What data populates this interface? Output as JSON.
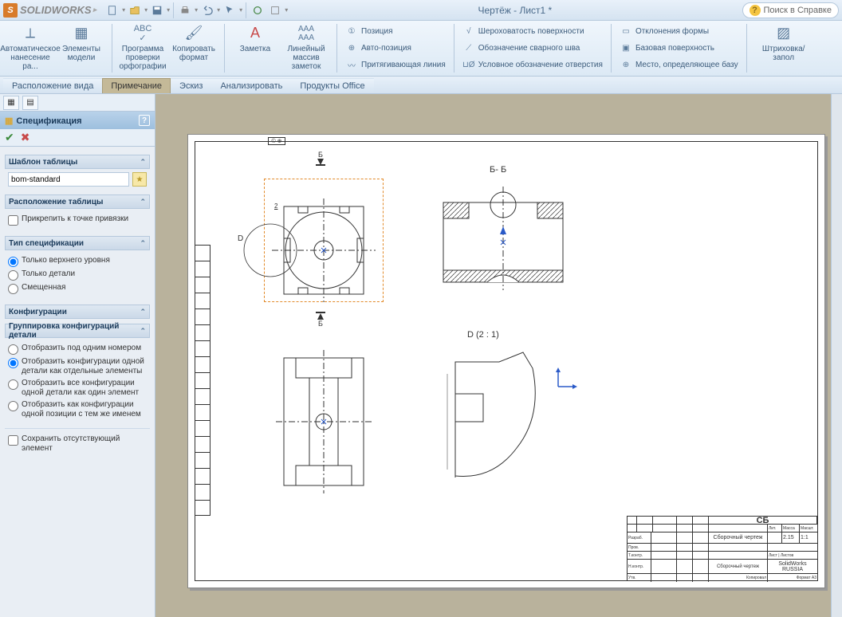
{
  "app": {
    "name": "SOLIDWORKS",
    "doc_title": "Чертёж - Лист1 *",
    "help_search": "Поиск в Справке"
  },
  "ribbon": {
    "big": [
      {
        "label1": "Автоматическое",
        "label2": "нанесение ра..."
      },
      {
        "label1": "Элементы",
        "label2": "модели"
      },
      {
        "label1": "Программа",
        "label2": "проверки",
        "label3": "орфографии"
      },
      {
        "label1": "Копировать",
        "label2": "формат"
      },
      {
        "label1": "Заметка",
        "label2": ""
      },
      {
        "label1": "Линейный",
        "label2": "массив",
        "label3": "заметок"
      }
    ],
    "col1": [
      {
        "label": "Позиция"
      },
      {
        "label": "Авто-позиция"
      },
      {
        "label": "Притягивающая линия"
      }
    ],
    "col2": [
      {
        "label": "Шероховатость поверхности"
      },
      {
        "label": "Обозначение сварного шва"
      },
      {
        "label": "Условное обозначение отверстия"
      }
    ],
    "col3": [
      {
        "label": "Отклонения формы"
      },
      {
        "label": "Базовая поверхность"
      },
      {
        "label": "Место, определяющее базу"
      }
    ],
    "big_end": {
      "label1": "Штриховка/запол",
      "label2": ""
    }
  },
  "tabs": {
    "t1": "Расположение вида",
    "t2": "Примечание",
    "t3": "Эскиз",
    "t4": "Анализировать",
    "t5": "Продукты Office"
  },
  "panel": {
    "title": "Спецификация",
    "sec_template": "Шаблон таблицы",
    "template_value": "bom-standard",
    "sec_layout": "Расположение таблицы",
    "layout_opt": "Прикрепить к точке привязки",
    "sec_type": "Тип спецификации",
    "type_opts": [
      "Только верхнего уровня",
      "Только детали",
      "Смещенная"
    ],
    "sec_config": "Конфигурации",
    "sec_group": "Группировка конфигураций детали",
    "group_opts": [
      "Отобразить под одним номером",
      "Отобразить конфигурации одной детали как отдельные элементы",
      "Отобразить все конфигурации одной детали как один элемент",
      "Отобразить как конфигурации одной позиции с тем же именем"
    ],
    "save_missing": "Сохранить отсутствующий элемент"
  },
  "drawing": {
    "proj": "© ⊕",
    "section_label_top": "Б",
    "section_bb": "Б- Б",
    "detail_d_callout": "D",
    "detail_d_title": "D  (2 : 1)",
    "dim2": "2",
    "title_sb": "СБ",
    "title_desc": "Сборочный чертеж",
    "title_sw": "SolidWorks RUSSIA",
    "scale": "1:1",
    "mass": "2.15"
  }
}
